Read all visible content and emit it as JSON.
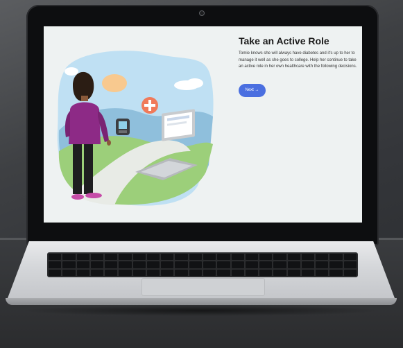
{
  "page": {
    "title": "Take an Active Role",
    "body_lines": [
      "Tomie knows she will always have diabetes and it's up to her to",
      "manage it well as she goes to college. Help her continue to take",
      "an active role in her own healthcare with the following decisions."
    ],
    "next_button": "Next →"
  },
  "colors": {
    "accent": "#4a6fe0",
    "screen_bg": "#eef2f2",
    "medical_badge": "#f07a5a"
  },
  "icons": [
    "medical-cross-icon",
    "glucose-meter-icon",
    "laptop-icon",
    "arrow-right-icon"
  ]
}
